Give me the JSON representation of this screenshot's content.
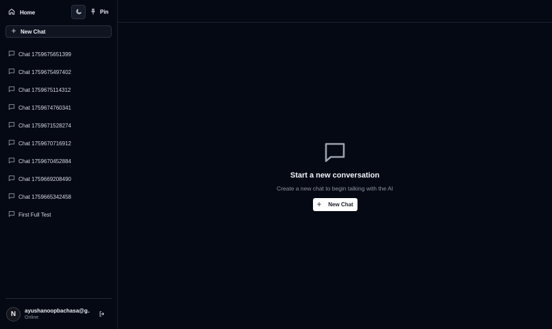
{
  "sidebar": {
    "home_label": "Home",
    "pin_label": "Pin",
    "new_chat_label": "New Chat",
    "chats": [
      "Chat 1759675651399",
      "Chat 1759675497402",
      "Chat 1759675114312",
      "Chat 1759674760341",
      "Chat 1759671528274",
      "Chat 1759670716912",
      "Chat 1759670452884",
      "Chat 1759669208490",
      "Chat 1759665342458",
      "First Full Test"
    ],
    "user": {
      "avatar_letter": "N",
      "email": "ayushanoopbachasa@g...",
      "status": "Online"
    }
  },
  "main": {
    "title": "Start a new conversation",
    "subtitle": "Create a new chat to begin talking with the AI",
    "new_chat_label": "New Chat"
  },
  "icons": {
    "home": "home-icon",
    "theme": "moon-icon",
    "pin": "pin-icon",
    "plus": "plus-icon",
    "chat": "message-square-icon",
    "logout": "logout-icon"
  },
  "colors": {
    "background": "#050914",
    "border": "#1b2130",
    "primary_button": "#ffffff"
  }
}
